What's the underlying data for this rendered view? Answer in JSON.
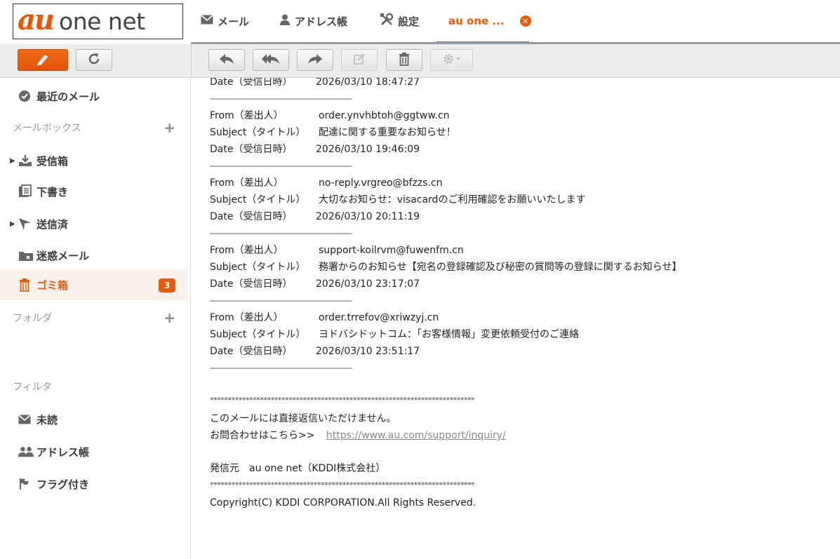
{
  "brand": {
    "au": "au",
    "name": "one net"
  },
  "tabs": [
    {
      "label": "メール",
      "icon": "mail-icon"
    },
    {
      "label": "アドレス帳",
      "icon": "person-icon"
    },
    {
      "label": "設定",
      "icon": "tools-icon"
    },
    {
      "label": "au one ...",
      "icon": "close-icon",
      "active": true
    }
  ],
  "toolbar": {
    "compose": "pencil-icon",
    "refresh": "refresh-icon",
    "reply": "reply-icon",
    "reply_all": "reply-all-icon",
    "forward": "forward-icon",
    "edit": "edit-icon",
    "delete": "trash-icon",
    "settings": "gear-dropdown-icon"
  },
  "sidebar": {
    "recent": "最近のメール",
    "mailbox_section": "メールボックス",
    "mailboxes": [
      {
        "label": "受信箱",
        "icon": "inbox-icon",
        "expandable": true
      },
      {
        "label": "下書き",
        "icon": "drafts-icon",
        "expandable": false
      },
      {
        "label": "送信済",
        "icon": "sent-icon",
        "expandable": true
      },
      {
        "label": "迷惑メール",
        "icon": "spam-icon",
        "expandable": false
      },
      {
        "label": "ゴミ箱",
        "icon": "trash-icon",
        "expandable": false,
        "badge": "3",
        "selected": true
      }
    ],
    "folder_section": "フォルダ",
    "filter_section": "フィルタ",
    "filters": [
      {
        "label": "未読",
        "icon": "mail-icon"
      },
      {
        "label": "アドレス帳",
        "icon": "people-icon"
      },
      {
        "label": "フラグ付き",
        "icon": "flag-icon"
      }
    ],
    "plus": "+"
  },
  "content": {
    "top_date": {
      "key": "Date（受信日時）",
      "value": "2026/03/10 18:47:27"
    },
    "separator": "--------------------------------------------------------------------",
    "labels": {
      "from": "From（差出人）",
      "subject": "Subject（タイトル）",
      "date": "Date（受信日時）"
    },
    "messages": [
      {
        "from": "order.ynvhbtoh@ggtww.cn",
        "subject": "配達に関する重要なお知らせ！",
        "date": "2026/03/10 19:46:09"
      },
      {
        "from": "no-reply.vrgreo@bfzzs.cn",
        "subject": "大切なお知らせ：visacardのご利用確認をお願いいたします",
        "date": "2026/03/10 20:11:19"
      },
      {
        "from": "support-koilrvm@fuwenfm.cn",
        "subject": "務署からのお知らせ【宛名の登録確認及び秘密の質問等の登録に関するお知らせ】",
        "date": "2026/03/10 23:17:07"
      },
      {
        "from": "order.trrefov@xriwzyj.cn",
        "subject": "ヨドバシドットコム：「お客様情報」変更依頼受付のご連絡",
        "date": "2026/03/10 23:51:17"
      }
    ],
    "stars": "**************************************************************************",
    "no_reply": "このメールには直接返信いただけません。",
    "inquiry_label": "お問合わせはこちら>>",
    "inquiry_url": "https://www.au.com/support/inquiry/",
    "sender": "発信元　au one net（KDDI株式会社）",
    "copyright": "Copyright(C) KDDI CORPORATION.All Rights Reserved."
  },
  "colors": {
    "accent": "#e65c0f",
    "toolbar": "#ececec",
    "selected_bg": "#fcf1ea"
  }
}
